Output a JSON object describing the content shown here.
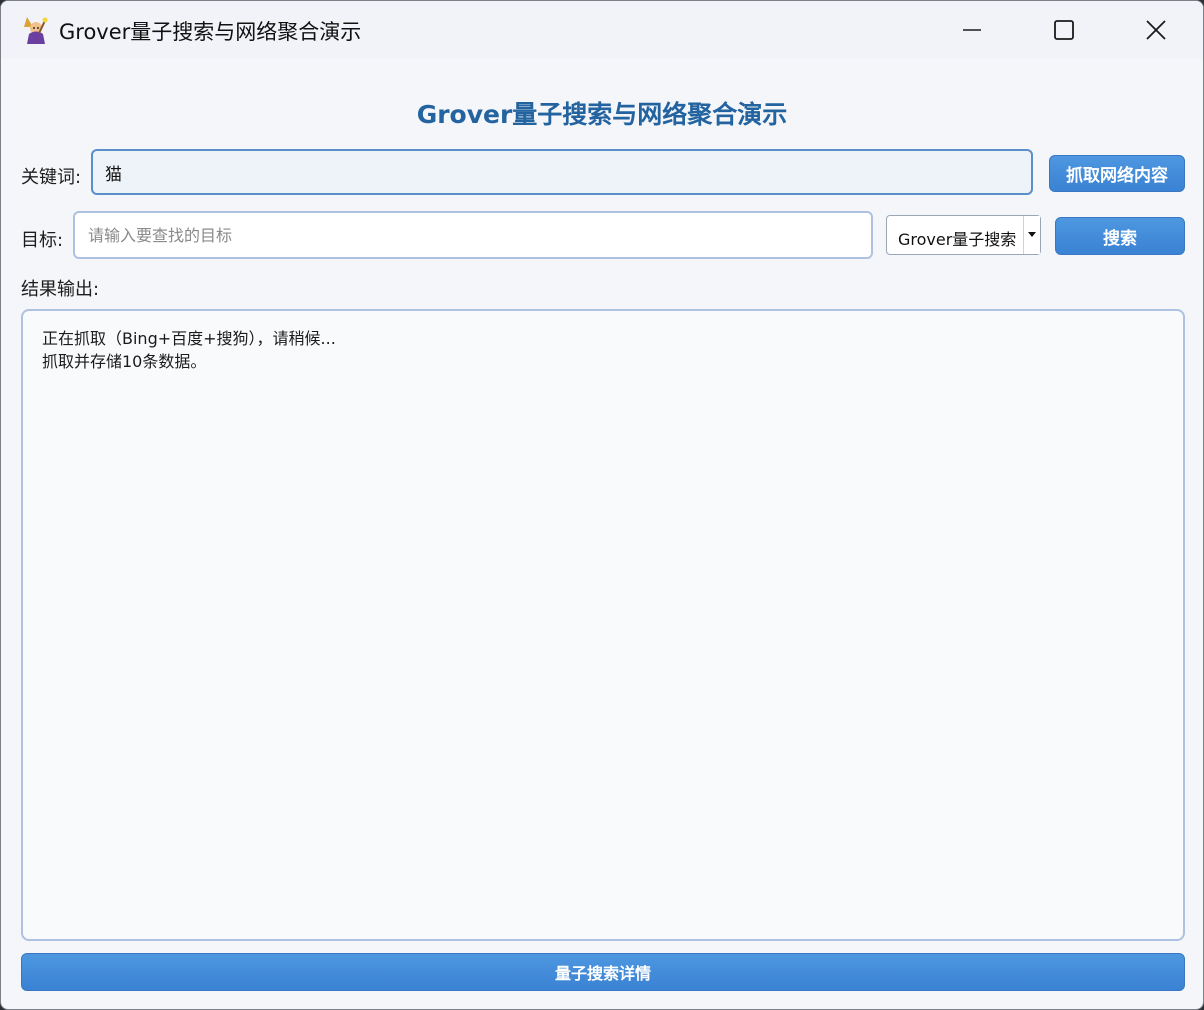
{
  "window": {
    "title": "Grover量子搜索与网络聚合演示",
    "app_icon": "wizard-icon",
    "controls": [
      "minimize-icon",
      "maximize-icon",
      "close-icon"
    ]
  },
  "main": {
    "heading": "Grover量子搜索与网络聚合演示",
    "keyword": {
      "label": "关键词:",
      "value": "猫"
    },
    "fetch_button": "抓取网络内容",
    "target": {
      "label": "目标:",
      "value": "",
      "placeholder": "请输入要查找的目标"
    },
    "algorithm_select": {
      "selected": "Grover量子搜索"
    },
    "search_button": "搜索",
    "output": {
      "label": "结果输出:",
      "lines": [
        "正在抓取（Bing+百度+搜狗），请稍候...",
        "抓取并存储10条数据。"
      ]
    },
    "detail_button": "量子搜索详情"
  },
  "colors": {
    "accent": "#3a82d3",
    "heading": "#23639f",
    "background": "#f4f6f9"
  }
}
